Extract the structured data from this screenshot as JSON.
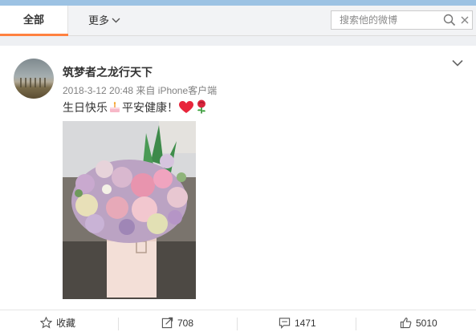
{
  "tabs": {
    "all": "全部",
    "more": "更多"
  },
  "search": {
    "placeholder": "搜索他的微博"
  },
  "post": {
    "username": "筑梦者之龙行天下",
    "timestamp": "2018-3-12 20:48",
    "source_prefix": "来自",
    "source": "iPhone客户端",
    "text_part1": "生日快乐",
    "text_part2": "平安健康！",
    "emojis": [
      "cake-icon",
      "heart-icon",
      "rose-icon"
    ]
  },
  "actions": {
    "favorite_label": "收藏",
    "repost_count": "708",
    "comment_count": "1471",
    "like_count": "5010"
  },
  "colors": {
    "accent_tab": "#ff8140",
    "top_band": "#9cc2e3",
    "heart": "#e8253b",
    "rose": "#d9263d"
  }
}
